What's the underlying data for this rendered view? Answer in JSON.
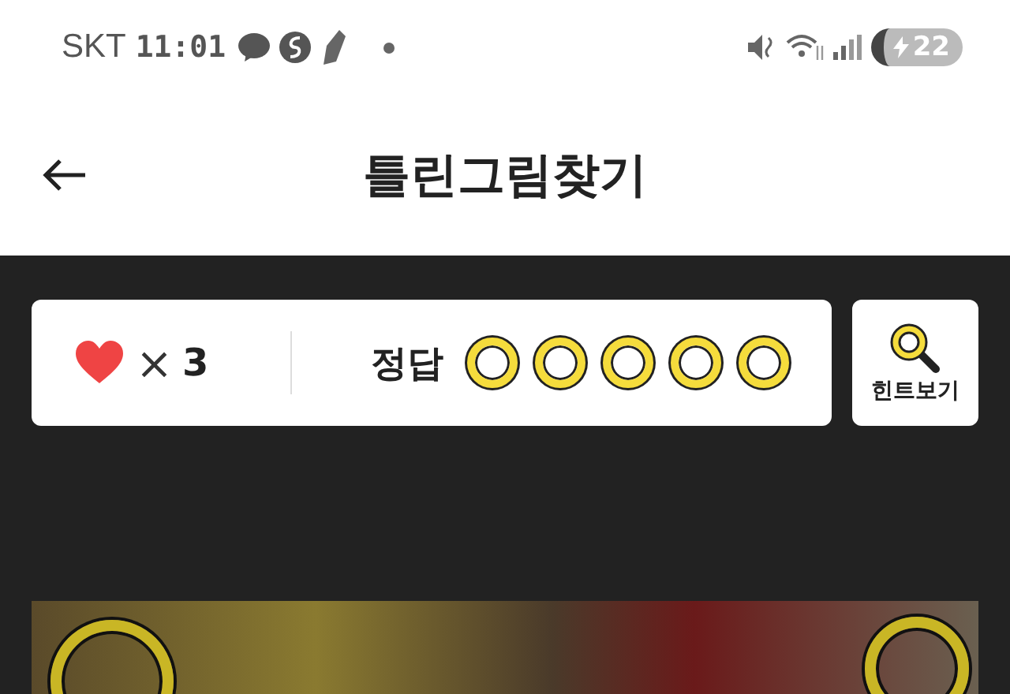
{
  "status_bar": {
    "carrier": "SKT",
    "time": "11:01",
    "battery": "22"
  },
  "header": {
    "title": "틀린그림찾기"
  },
  "score_card": {
    "lives_symbol": "×",
    "lives": "3",
    "answers_label": "정답",
    "answers": [
      {
        "found": false
      },
      {
        "found": false
      },
      {
        "found": false
      },
      {
        "found": false
      },
      {
        "found": false
      }
    ]
  },
  "hint_button": {
    "label": "힌트보기"
  }
}
